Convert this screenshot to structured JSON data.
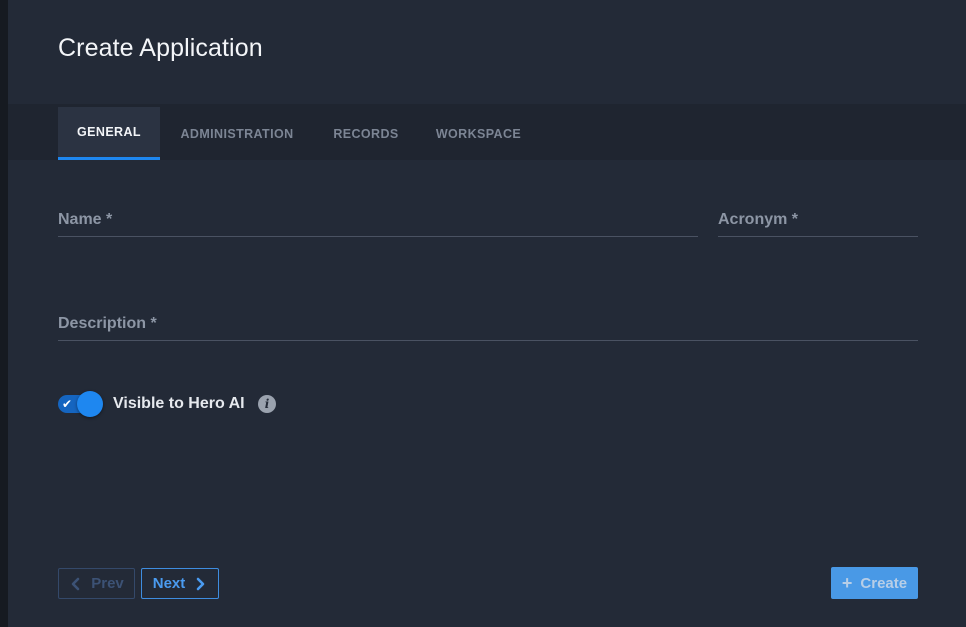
{
  "dialog": {
    "title": "Create Application"
  },
  "tabs": [
    {
      "label": "GENERAL",
      "active": true
    },
    {
      "label": "ADMINISTRATION",
      "active": false
    },
    {
      "label": "RECORDS",
      "active": false
    },
    {
      "label": "WORKSPACE",
      "active": false
    }
  ],
  "form": {
    "name": {
      "label": "Name  *",
      "value": ""
    },
    "acronym": {
      "label": "Acronym  *",
      "value": ""
    },
    "description": {
      "label": "Description  *",
      "value": ""
    },
    "visible_toggle": {
      "label": "Visible to Hero AI",
      "checked": true
    }
  },
  "footer": {
    "prev_label": "Prev",
    "next_label": "Next",
    "create_label": "Create"
  },
  "icons": {
    "info": "info-icon",
    "check": "check-icon",
    "prev": "chevron-left-icon",
    "next": "chevron-right-icon",
    "create": "plus-icon"
  },
  "colors": {
    "accent": "#1e87f0",
    "background": "#232a37",
    "create_button": "#4da3f5"
  }
}
